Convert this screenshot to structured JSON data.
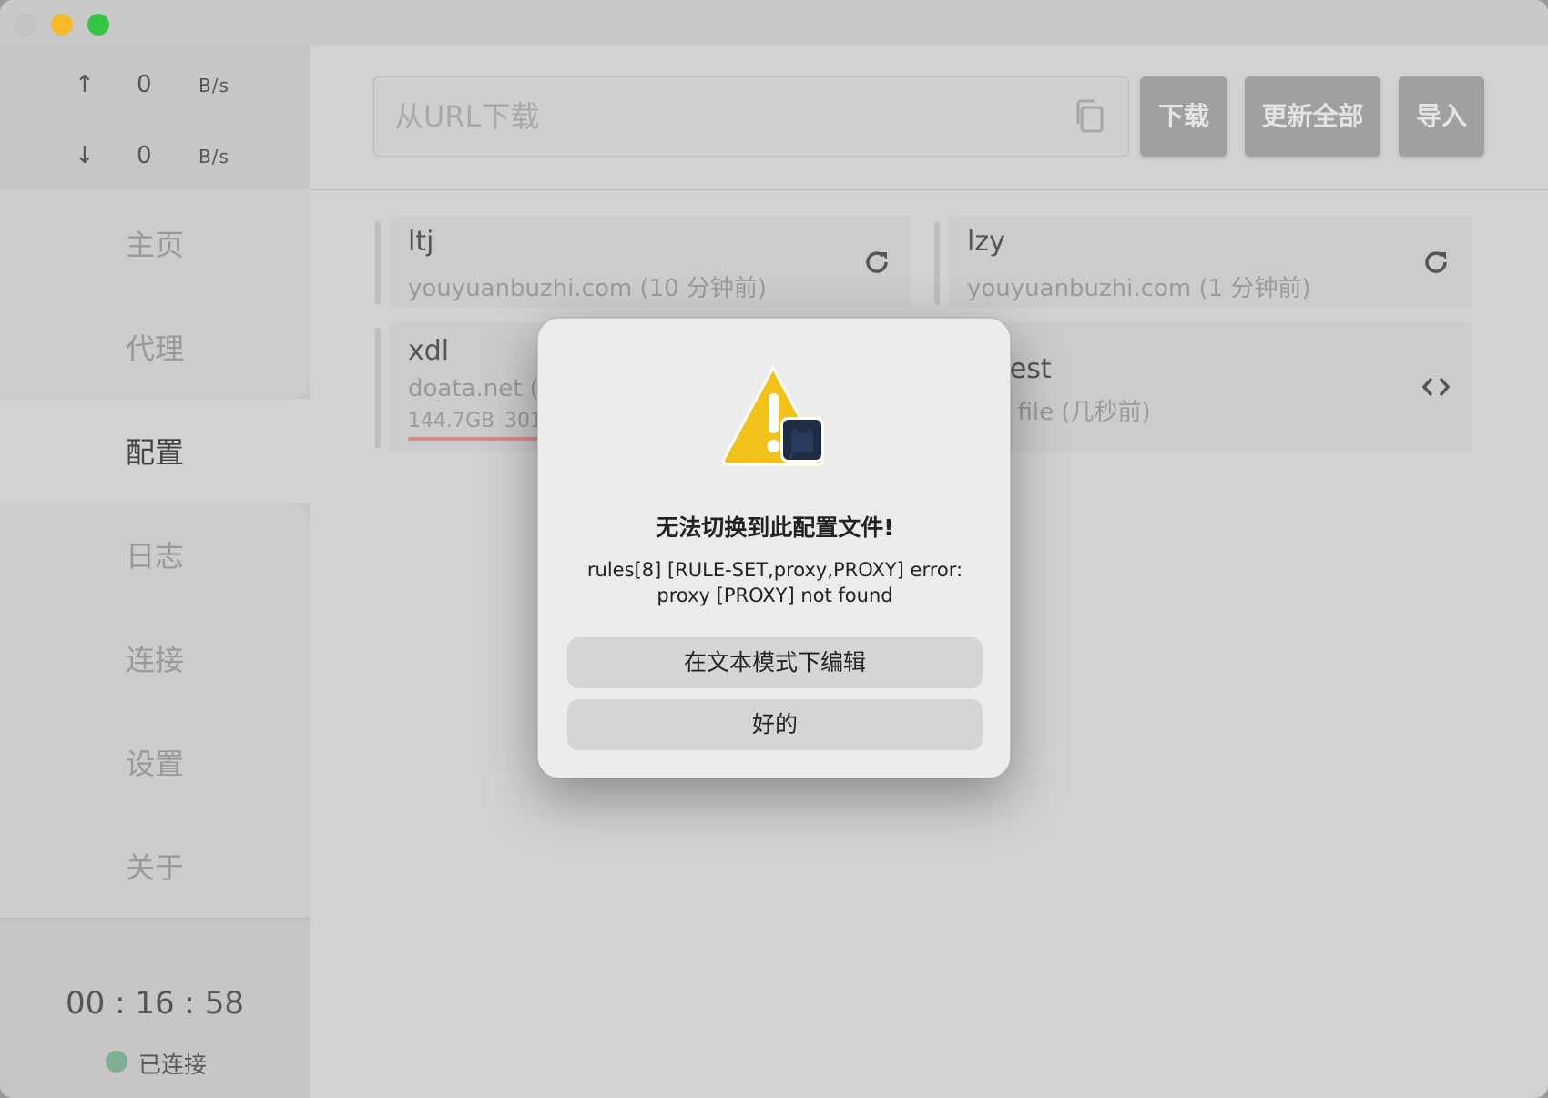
{
  "window": {
    "controls": [
      "close",
      "minimize",
      "maximize"
    ]
  },
  "sidebar": {
    "upload": {
      "arrow": "↑",
      "value": "0",
      "unit": "B/s"
    },
    "download": {
      "arrow": "↓",
      "value": "0",
      "unit": "B/s"
    },
    "nav": [
      {
        "label": "主页",
        "active": false
      },
      {
        "label": "代理",
        "active": false
      },
      {
        "label": "配置",
        "active": true
      },
      {
        "label": "日志",
        "active": false
      },
      {
        "label": "连接",
        "active": false
      },
      {
        "label": "设置",
        "active": false
      },
      {
        "label": "关于",
        "active": false
      }
    ],
    "timer": "00 : 16 : 58",
    "status": "已连接",
    "status_color": "#7fae94"
  },
  "toolbar": {
    "url_placeholder": "从URL下载",
    "download_label": "下载",
    "update_all_label": "更新全部",
    "import_label": "导入"
  },
  "profiles": [
    {
      "name": "ltj",
      "source": "youyuanbuzhi.com (10 分钟前)"
    },
    {
      "name": "lzy",
      "source": "youyuanbuzhi.com (1 分钟前)"
    },
    {
      "name": "xdl",
      "source": "doata.net (1",
      "usage": "144.7GB",
      "extra": "301"
    },
    {
      "name": "_test",
      "source": "l file (几秒前)"
    }
  ],
  "dialog": {
    "title": "无法切换到此配置文件!",
    "message_line1": "rules[8] [RULE-SET,proxy,PROXY] error:",
    "message_line2": "proxy [PROXY] not found",
    "edit_button": "在文本模式下编辑",
    "ok_button": "好的"
  },
  "colors": {
    "accent_progress": "#d98a8a",
    "warning_yellow": "#f2c21b"
  }
}
